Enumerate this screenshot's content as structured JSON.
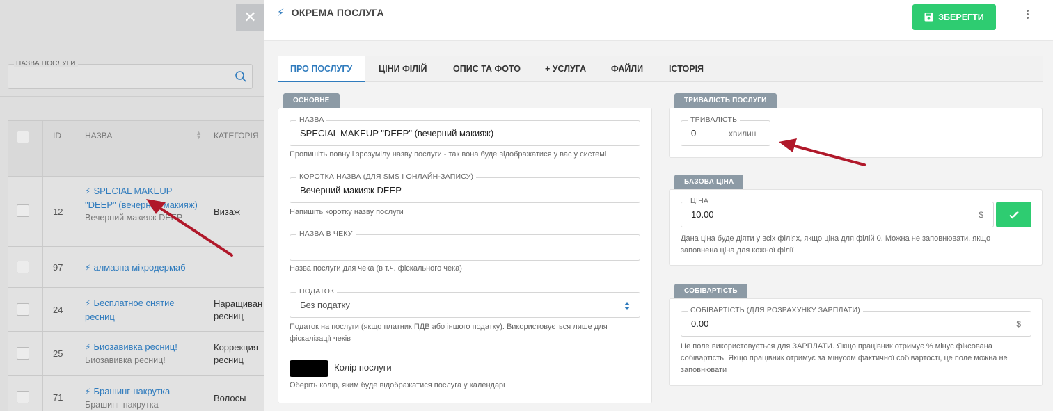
{
  "background": {
    "search_label": "НАЗВА ПОСЛУГИ",
    "columns": {
      "id": "ID",
      "name": "НАЗВА",
      "category": "КАТЕГОРІЯ"
    },
    "rows": [
      {
        "id": "12",
        "name": "SPECIAL MAKEUP \"DEEP\" (вечерний макияж)",
        "sub": "Вечерний макияж DEEP",
        "category": "Визаж"
      },
      {
        "id": "97",
        "name": "алмазна мікродермаб",
        "sub": "",
        "category": ""
      },
      {
        "id": "24",
        "name": "Бесплатное снятие ресниц",
        "sub": "",
        "category": "Наращиван ресниц"
      },
      {
        "id": "25",
        "name": "Биозавивка ресниц!",
        "sub": "Биозавивка ресниц!",
        "category": "Коррекция ресниц"
      },
      {
        "id": "71",
        "name": "Брашинг-накрутка",
        "sub": "Брашинг-накрутка",
        "category": "Волосы"
      }
    ],
    "close_icon": "close-icon"
  },
  "panel": {
    "title": "ОКРЕМА ПОСЛУГА",
    "save_label": "ЗБЕРЕГТИ",
    "tabs": [
      {
        "label": "ПРО ПОСЛУГУ",
        "active": true
      },
      {
        "label": "ЦІНИ ФІЛІЙ",
        "active": false
      },
      {
        "label": "ОПИС ТА ФОТО",
        "active": false
      },
      {
        "label": "+ УСЛУГА",
        "active": false
      },
      {
        "label": "ФАЙЛИ",
        "active": false
      },
      {
        "label": "ІСТОРІЯ",
        "active": false
      }
    ],
    "main": {
      "section": "ОСНОВНЕ",
      "name_label": "НАЗВА",
      "name_value": "SPECIAL MAKEUP \"DEEP\" (вечерний макияж)",
      "name_hint": "Пропишіть повну і зрозумілу назву послуги - так вона буде відображатися у вас у системі",
      "short_label": "КОРОТКА НАЗВА (ДЛЯ SMS І ОНЛАЙН-ЗАПИСУ)",
      "short_value": "Вечерний макияж DEEP",
      "short_hint": "Напишіть коротку назву послуги",
      "receipt_label": "НАЗВА В ЧЕКУ",
      "receipt_value": "",
      "receipt_hint": "Назва послуги для чека (в т.ч. фіскального чека)",
      "tax_label": "ПОДАТОК",
      "tax_value": "Без податку",
      "tax_hint": "Податок на послуги (якщо платник ПДВ або іншого податку). Використовується лише для фіскалізації чеків",
      "color_label": "Колір послуги",
      "color_value": "#000000",
      "color_hint": "Оберіть колір, яким буде відображатися послуга у календарі"
    },
    "duration": {
      "section": "ТРИВАЛІСТЬ ПОСЛУГИ",
      "label": "ТРИВАЛІСТЬ",
      "value": "0",
      "unit": "хвилин"
    },
    "price": {
      "section": "БАЗОВА ЦІНА",
      "label": "ЦІНА",
      "value": "10.00",
      "currency": "$",
      "hint": "Дана ціна буде діяти у всіх філіях, якщо ціна для філій 0. Можна не заповнювати, якщо заповнена ціна для кожної філії"
    },
    "cost": {
      "section": "СОБІВАРТІСТЬ",
      "label": "СОБІВАРТІСТЬ (ДЛЯ РОЗРАХУНКУ ЗАРПЛАТИ)",
      "value": "0.00",
      "currency": "$",
      "hint": "Це поле використовується для ЗАРПЛАТИ. Якщо працівник отримує % мінус фіксована собівартість. Якщо працівник отримує за мінусом фактичної собівартості, це поле можна не заповнювати"
    }
  },
  "colors": {
    "accent": "#2f7bbd",
    "success": "#2ecc71",
    "tag": "#8c9aa5",
    "annotation_arrow": "#b0182a"
  }
}
